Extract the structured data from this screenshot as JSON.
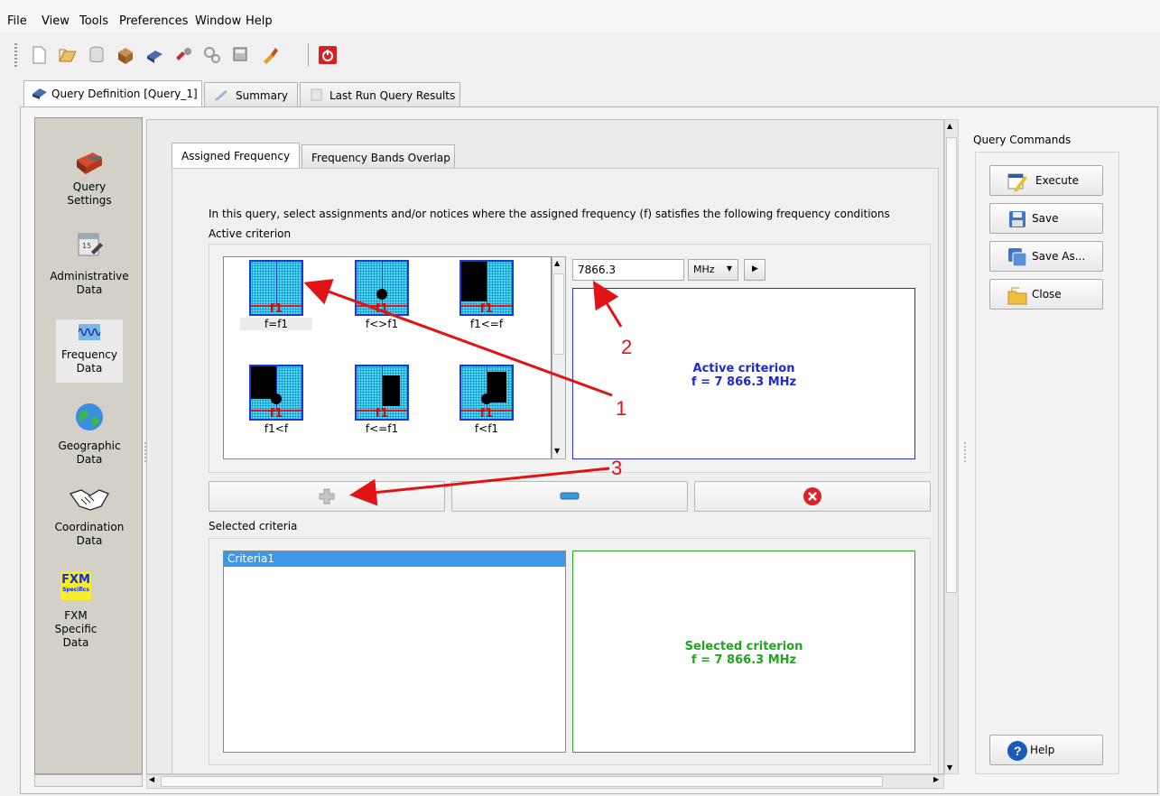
{
  "menu": [
    "File",
    "View",
    "Tools",
    "Preferences",
    "Window",
    "Help"
  ],
  "main_tabs": [
    {
      "label": "Query Definition [Query_1]",
      "active": true
    },
    {
      "label": "Summary",
      "active": false
    },
    {
      "label": "Last Run Query Results",
      "active": false
    }
  ],
  "sidebar": {
    "items": [
      {
        "label": "Query\nSettings"
      },
      {
        "label": "Administrative\nData"
      },
      {
        "label": "Frequency\nData"
      },
      {
        "label": "Geographic\nData"
      },
      {
        "label": "Coordination\nData"
      },
      {
        "label": "FXM\nSpecific\nData"
      }
    ],
    "fxm_logo": "FXM",
    "fxm_logo_sub": "Specifics"
  },
  "sub_tabs": [
    {
      "label": "Assigned Frequency",
      "active": true
    },
    {
      "label": "Frequency Bands Overlap",
      "active": false
    }
  ],
  "instruction": "In this query, select assignments and/or notices where the assigned frequency (f) satisfies the following frequency conditions",
  "active_criterion_heading": "Active criterion",
  "criteria_icons": [
    {
      "label": "f=f1",
      "marker": "f1"
    },
    {
      "label": "f<>f1",
      "marker": "f1"
    },
    {
      "label": "f1<=f",
      "marker": "f1"
    },
    {
      "label": "f1<f",
      "marker": "f1"
    },
    {
      "label": "f<=f1",
      "marker": "f1"
    },
    {
      "label": "f<f1",
      "marker": "f1"
    }
  ],
  "frequency_input": "7866.3",
  "unit": "MHz",
  "active_box": {
    "line1": "Active criterion",
    "line2": "f = 7 866.3 MHz"
  },
  "selected_heading": "Selected criteria",
  "selected_list": [
    "Criteria1"
  ],
  "selected_box": {
    "line1": "Selected criterion",
    "line2": "f = 7 866.3 MHz"
  },
  "commands": {
    "heading": "Query Commands",
    "execute": "Execute",
    "save": "Save",
    "save_as": "Save As...",
    "close": "Close",
    "help": "Help"
  },
  "annotations": [
    "1",
    "2",
    "3"
  ],
  "colors": {
    "annotation": "#e01414",
    "active_text": "#1e28d8",
    "selected_text": "#1fa51f",
    "selection": "#3c99e8"
  }
}
